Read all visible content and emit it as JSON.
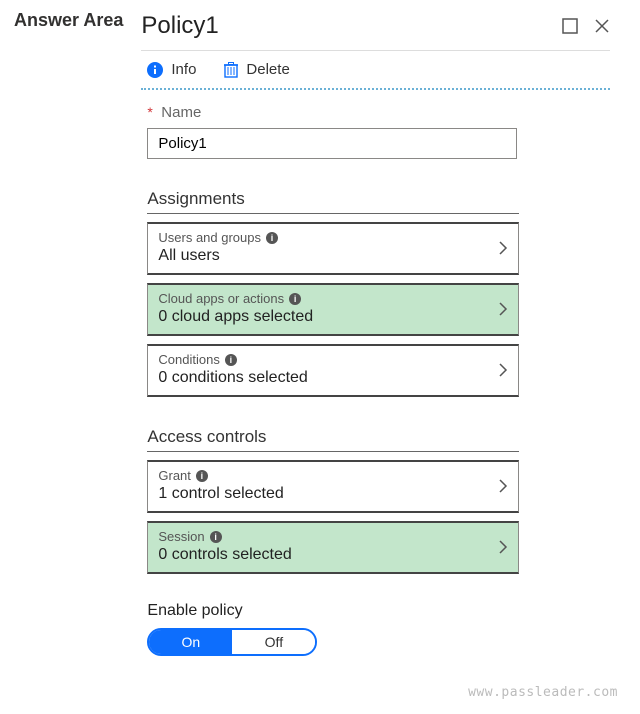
{
  "answer_area": "Answer Area",
  "title": "Policy1",
  "toolbar": {
    "info": "Info",
    "delete": "Delete"
  },
  "name_field": {
    "label": "Name",
    "value": "Policy1"
  },
  "sections": {
    "assignments": {
      "heading": "Assignments",
      "rows": [
        {
          "label": "Users and groups",
          "value": "All users",
          "highlight": false
        },
        {
          "label": "Cloud apps or actions",
          "value": "0 cloud apps selected",
          "highlight": true
        },
        {
          "label": "Conditions",
          "value": "0 conditions selected",
          "highlight": false
        }
      ]
    },
    "access": {
      "heading": "Access controls",
      "rows": [
        {
          "label": "Grant",
          "value": "1 control selected",
          "highlight": false
        },
        {
          "label": "Session",
          "value": "0 controls selected",
          "highlight": true
        }
      ]
    }
  },
  "enable": {
    "label": "Enable policy",
    "on": "On",
    "off": "Off"
  },
  "watermark": "www.passleader.com"
}
